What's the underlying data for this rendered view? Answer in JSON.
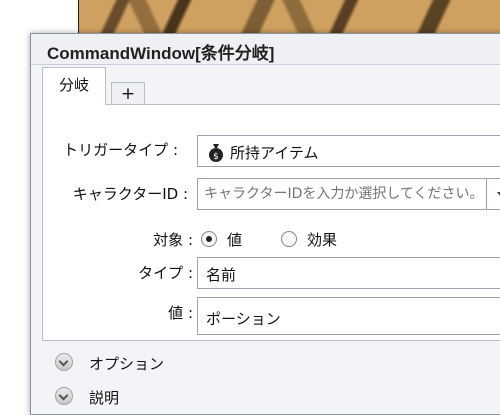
{
  "window": {
    "title": "CommandWindow[条件分岐]"
  },
  "tabs": [
    {
      "label": "分岐"
    },
    {
      "label": "+"
    }
  ],
  "form": {
    "trigger_type": {
      "label": "トリガータイプ :",
      "value": "所持アイテム"
    },
    "character_id": {
      "label": "キャラクターID :",
      "placeholder": "キャラクターIDを入力か選択してください。"
    },
    "target": {
      "label": "対象 :",
      "options": [
        "値",
        "効果"
      ],
      "selected": "値"
    },
    "type": {
      "label": "タイプ :",
      "value": "名前"
    },
    "value": {
      "label": "値 :",
      "value": "ポーション"
    }
  },
  "sections": [
    {
      "label": "オプション"
    },
    {
      "label": "説明"
    }
  ]
}
